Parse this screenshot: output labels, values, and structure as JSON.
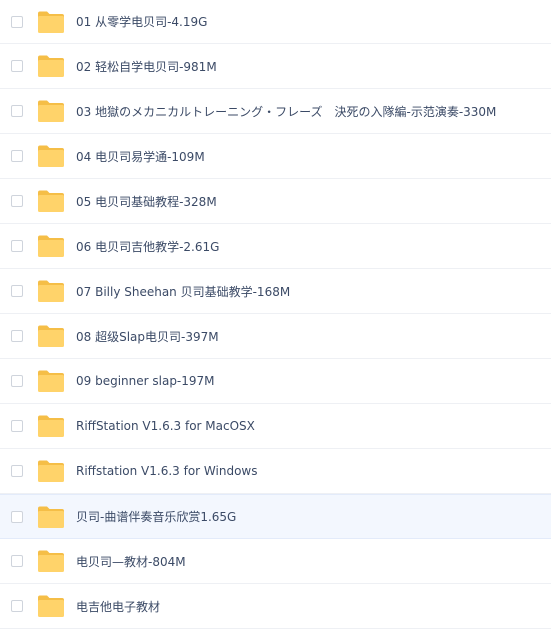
{
  "colors": {
    "folder_body": "#FFD36A",
    "folder_tab": "#F5BE47",
    "text": "#3B4A66",
    "row_divider": "#EEF0F4",
    "highlight_bg": "#F3F7FE"
  },
  "files": [
    {
      "name": "01 从零学电贝司-4.19G",
      "icon": "folder-icon"
    },
    {
      "name": "02 轻松自学电贝司-981M",
      "icon": "folder-icon"
    },
    {
      "name": "03 地獄のメカニカルトレーニング・フレーズ　決死の入隊編-示范演奏-330M",
      "icon": "folder-icon"
    },
    {
      "name": "04 电贝司易学通-109M",
      "icon": "folder-icon"
    },
    {
      "name": "05 电贝司基础教程-328M",
      "icon": "folder-icon"
    },
    {
      "name": "06 电贝司吉他教学-2.61G",
      "icon": "folder-icon"
    },
    {
      "name": "07 Billy Sheehan 贝司基础教学-168M",
      "icon": "folder-icon"
    },
    {
      "name": "08 超级Slap电贝司-397M",
      "icon": "folder-icon"
    },
    {
      "name": "09 beginner slap-197M",
      "icon": "folder-icon"
    },
    {
      "name": "RiffStation V1.6.3 for MacOSX",
      "icon": "folder-icon"
    },
    {
      "name": "Riffstation V1.6.3 for Windows",
      "icon": "folder-icon"
    },
    {
      "name": "贝司-曲谱伴奏音乐欣赏1.65G",
      "icon": "folder-icon"
    },
    {
      "name": "电贝司—教材-804M",
      "icon": "folder-icon"
    },
    {
      "name": "电吉他电子教材",
      "icon": "folder-icon"
    }
  ]
}
